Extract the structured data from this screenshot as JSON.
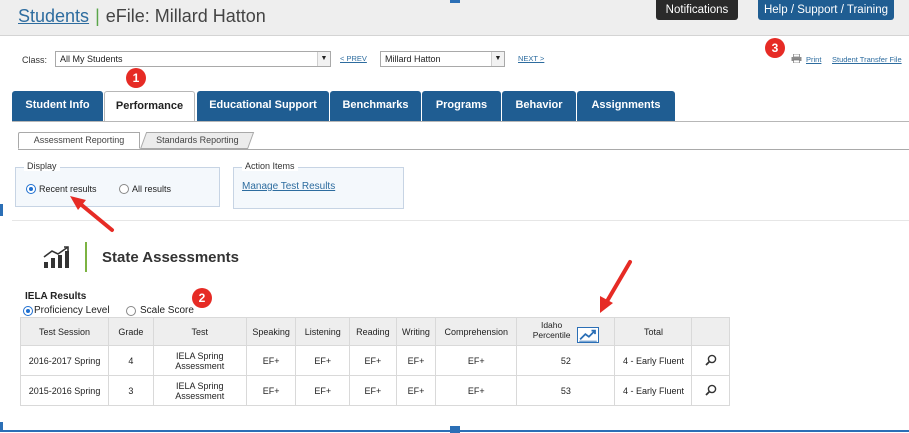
{
  "header": {
    "breadcrumb_link": "Students",
    "title": "eFile: Millard Hatton",
    "notifications_label": "Notifications",
    "help_label": "Help / Support / Training"
  },
  "classrow": {
    "class_label": "Class:",
    "class_value": "All My Students",
    "prev_label": "< PREV",
    "student_value": "Millard Hatton",
    "next_label": "NEXT >",
    "print_label": "Print",
    "transfer_label": "Student Transfer File"
  },
  "badges": [
    "1",
    "2",
    "3"
  ],
  "tabs": [
    {
      "label": "Student Info",
      "active": false
    },
    {
      "label": "Performance",
      "active": true
    },
    {
      "label": "Educational Support",
      "active": false
    },
    {
      "label": "Benchmarks",
      "active": false
    },
    {
      "label": "Programs",
      "active": false
    },
    {
      "label": "Behavior",
      "active": false
    },
    {
      "label": "Assignments",
      "active": false
    }
  ],
  "subtabs": [
    "Assessment Reporting",
    "Standards Reporting"
  ],
  "display": {
    "legend": "Display",
    "recent": "Recent results",
    "all": "All results",
    "selected": "recent"
  },
  "actions": {
    "legend": "Action Items",
    "manage": "Manage Test Results"
  },
  "section": {
    "title": "State Assessments",
    "subtitle": "IELA Results",
    "proficiency": "Proficiency Level",
    "scale": "Scale Score",
    "selected": "proficiency"
  },
  "table": {
    "headers": [
      "Test Session",
      "Grade",
      "Test",
      "Speaking",
      "Listening",
      "Reading",
      "Writing",
      "Comprehension",
      "Idaho Percentile",
      "Total",
      ""
    ],
    "ip_line1": "Idaho",
    "ip_line2": "Percentile",
    "rows": [
      {
        "session": "2016-2017 Spring",
        "grade": "4",
        "test1": "IELA Spring",
        "test2": "Assessment",
        "speaking": "EF+",
        "listening": "EF+",
        "reading": "EF+",
        "writing": "EF+",
        "comprehension": "EF+",
        "percentile": "52",
        "total": "4 - Early Fluent"
      },
      {
        "session": "2015-2016 Spring",
        "grade": "3",
        "test1": "IELA Spring",
        "test2": "Assessment",
        "speaking": "EF+",
        "listening": "EF+",
        "reading": "EF+",
        "writing": "EF+",
        "comprehension": "EF+",
        "percentile": "53",
        "total": "4 - Early Fluent"
      }
    ]
  },
  "icons": {
    "print": "printer-icon",
    "trend": "trend-chart-icon",
    "bar": "bar-chart-icon",
    "detail": "magnifier-icon"
  },
  "colors": {
    "primary": "#1f5d92",
    "link": "#2d6c9f",
    "badge": "#e62b25",
    "accent_green": "#7cb342"
  }
}
